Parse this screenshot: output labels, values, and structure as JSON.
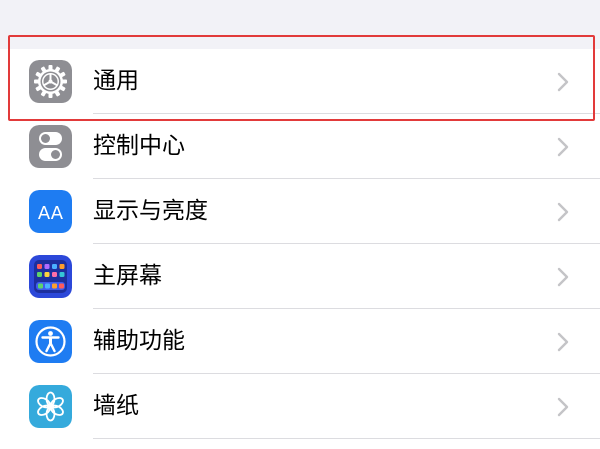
{
  "settings": {
    "items": [
      {
        "label": "通用",
        "icon": "gear-icon",
        "icon_color": "#8e8e93"
      },
      {
        "label": "控制中心",
        "icon": "toggles-icon",
        "icon_color": "#8e8e93"
      },
      {
        "label": "显示与亮度",
        "icon": "text-size-icon",
        "icon_color": "#1e7cf2"
      },
      {
        "label": "主屏幕",
        "icon": "home-screen-icon",
        "icon_color": "#2c48d9"
      },
      {
        "label": "辅助功能",
        "icon": "accessibility-icon",
        "icon_color": "#1e7cf2"
      },
      {
        "label": "墙纸",
        "icon": "wallpaper-flower-icon",
        "icon_color": "#35aadc"
      }
    ],
    "icon_texts": {
      "display": "AA"
    }
  },
  "colors": {
    "background": "#f2f2f7",
    "list_background": "#ffffff",
    "separator": "#dcdce0",
    "chevron": "#c4c4c7",
    "highlight": "#e23a3a"
  }
}
